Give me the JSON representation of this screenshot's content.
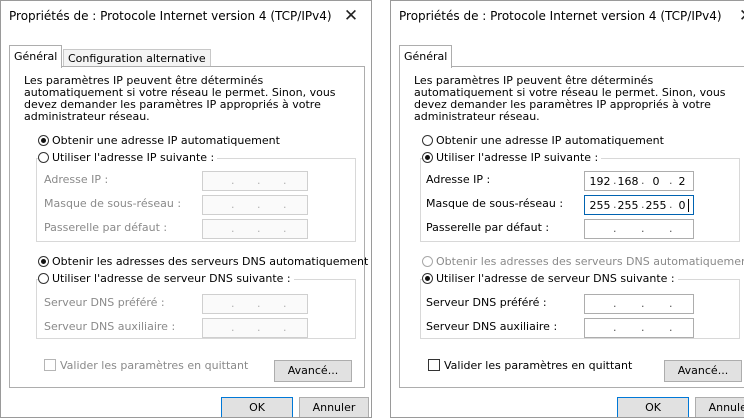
{
  "left_dialog": {
    "title": "Propriétés de : Protocole Internet version 4 (TCP/IPv4)",
    "close_glyph": "✕",
    "tabs": [
      {
        "label": "Général"
      },
      {
        "label": "Configuration alternative"
      }
    ],
    "description": "Les paramètres IP peuvent être déterminés automatiquement si votre réseau le permet. Sinon, vous devez demander les paramètres IP appropriés à votre administrateur réseau.",
    "ip_auto_label": "Obtenir une adresse IP automatiquement",
    "ip_manual_label": "Utiliser l'adresse IP suivante :",
    "ip_address_label": "Adresse IP :",
    "subnet_label": "Masque de sous-réseau :",
    "gateway_label": "Passerelle par défaut :",
    "dns_auto_label": "Obtenir les adresses des serveurs DNS automatiquement",
    "dns_manual_label": "Utiliser l'adresse de serveur DNS suivante :",
    "dns_pref_label": "Serveur DNS préféré :",
    "dns_alt_label": "Serveur DNS auxiliaire :",
    "validate_label": "Valider les paramètres en quittant",
    "advanced_label": "Avancé...",
    "ok_label": "OK",
    "cancel_label": "Annuler"
  },
  "right_dialog": {
    "title": "Propriétés de : Protocole Internet version 4 (TCP/IPv4)",
    "close_glyph": "✕",
    "tabs": [
      {
        "label": "Général"
      }
    ],
    "description": "Les paramètres IP peuvent être déterminés automatiquement si votre réseau le permet. Sinon, vous devez demander les paramètres IP appropriés à votre administrateur réseau.",
    "ip_auto_label": "Obtenir une adresse IP automatiquement",
    "ip_manual_label": "Utiliser l'adresse IP suivante :",
    "ip_address_label": "Adresse IP :",
    "subnet_label": "Masque de sous-réseau :",
    "gateway_label": "Passerelle par défaut :",
    "ip_address": [
      "192",
      "168",
      "0",
      "2"
    ],
    "subnet_mask": [
      "255",
      "255",
      "255",
      "0"
    ],
    "dns_auto_label": "Obtenir les adresses des serveurs DNS automatiquement",
    "dns_manual_label": "Utiliser l'adresse de serveur DNS suivante :",
    "dns_pref_label": "Serveur DNS préféré :",
    "dns_alt_label": "Serveur DNS auxiliaire :",
    "validate_label": "Valider les paramètres en quittant",
    "advanced_label": "Avancé...",
    "ok_label": "OK",
    "cancel_label": "Annuler"
  },
  "ip_separator": "."
}
